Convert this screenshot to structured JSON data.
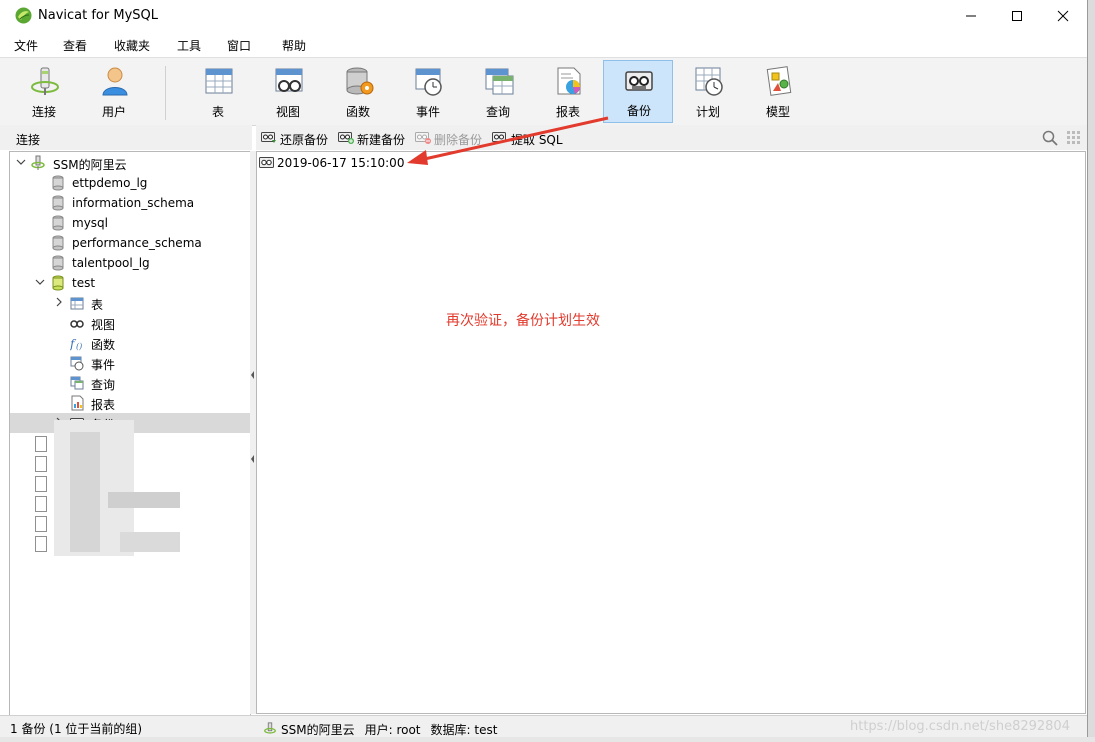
{
  "window": {
    "title": "Navicat for MySQL"
  },
  "menu": [
    "文件",
    "查看",
    "收藏夹",
    "工具",
    "窗口",
    "帮助"
  ],
  "toolbar": {
    "buttons": [
      {
        "label": "连接",
        "icon": "connection-plug-icon"
      },
      {
        "label": "用户",
        "icon": "user-person-icon"
      },
      {
        "label": "表",
        "icon": "table-grid-icon"
      },
      {
        "label": "视图",
        "icon": "view-glasses-icon"
      },
      {
        "label": "函数",
        "icon": "function-gear-icon"
      },
      {
        "label": "事件",
        "icon": "event-clock-icon"
      },
      {
        "label": "查询",
        "icon": "query-table-icon"
      },
      {
        "label": "报表",
        "icon": "report-chart-icon"
      },
      {
        "label": "备份",
        "icon": "backup-tape-icon",
        "active": true
      },
      {
        "label": "计划",
        "icon": "schedule-clock-icon"
      },
      {
        "label": "模型",
        "icon": "model-shapes-icon"
      }
    ]
  },
  "left_panel": {
    "header": "连接",
    "connection": "SSM的阿里云",
    "databases": [
      "ettpdemo_lg",
      "information_schema",
      "mysql",
      "performance_schema",
      "talentpool_lg",
      "test"
    ],
    "test_children": [
      "表",
      "视图",
      "函数",
      "事件",
      "查询",
      "报表",
      "备份"
    ]
  },
  "content_toolbar": {
    "restore": "还原备份",
    "new": "新建备份",
    "delete": "删除备份",
    "extract": "提取 SQL"
  },
  "content": {
    "backup_item": "2019-06-17 15:10:00",
    "annotation": "再次验证，备份计划生效"
  },
  "status": {
    "left": "1 备份 (1 位于当前的组)",
    "connection": "SSM的阿里云",
    "user": "用户: root",
    "database": "数据库: test",
    "watermark": "https://blog.csdn.net/she8292804"
  },
  "colors": {
    "annotation": "#e23a2c",
    "active_button_bg": "#cde5fa",
    "selected_row": "#d9d9d9"
  }
}
